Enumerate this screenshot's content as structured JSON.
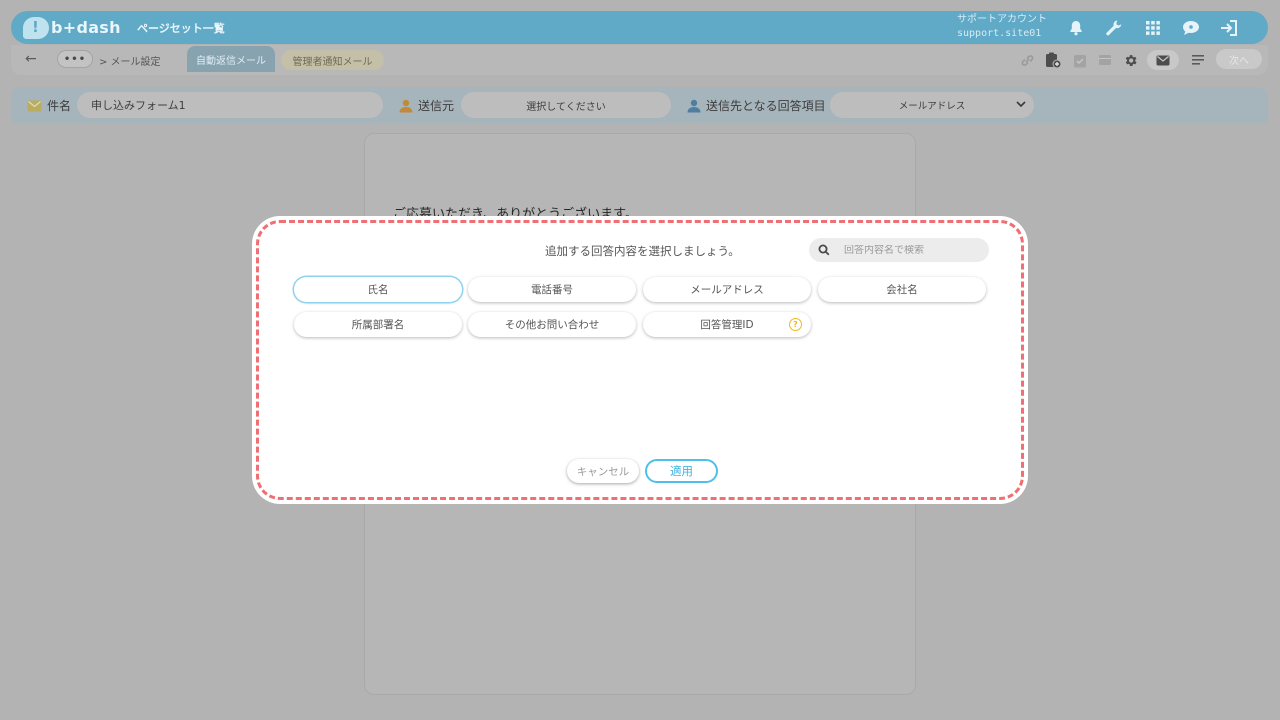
{
  "header": {
    "logo_text": "b+dash",
    "page_title": "ページセット一覧",
    "account_name": "サポートアカウント",
    "account_site": "support.site01"
  },
  "toolbar": {
    "dots_label": "•••",
    "breadcrumb": "> メール設定",
    "tabs": [
      {
        "label": "自動返信メール"
      },
      {
        "label": "管理者通知メール"
      }
    ],
    "next_label": "次へ"
  },
  "mail_form": {
    "subject_label": "件名",
    "subject_value": "申し込みフォーム1",
    "sender_label": "送信元",
    "sender_value": "選択してください",
    "recipient_label": "送信先となる回答項目",
    "recipient_value": "メールアドレス"
  },
  "preview": {
    "body_text": "ご応募いただき、ありがとうございます。"
  },
  "modal": {
    "title": "追加する回答内容を選択しましょう。",
    "search_placeholder": "回答内容名で検索",
    "options": [
      {
        "label": "氏名"
      },
      {
        "label": "電話番号"
      },
      {
        "label": "メールアドレス"
      },
      {
        "label": "会社名"
      },
      {
        "label": "所属部署名"
      },
      {
        "label": "その他お問い合わせ"
      },
      {
        "label": "回答管理ID",
        "help": "?"
      }
    ],
    "cancel_label": "キャンセル",
    "apply_label": "適用"
  },
  "colors": {
    "header_bg": "#60aac8",
    "modal_border": "#ef6f73",
    "accent": "#4fc0e8",
    "help_badge": "#f0b81c"
  }
}
